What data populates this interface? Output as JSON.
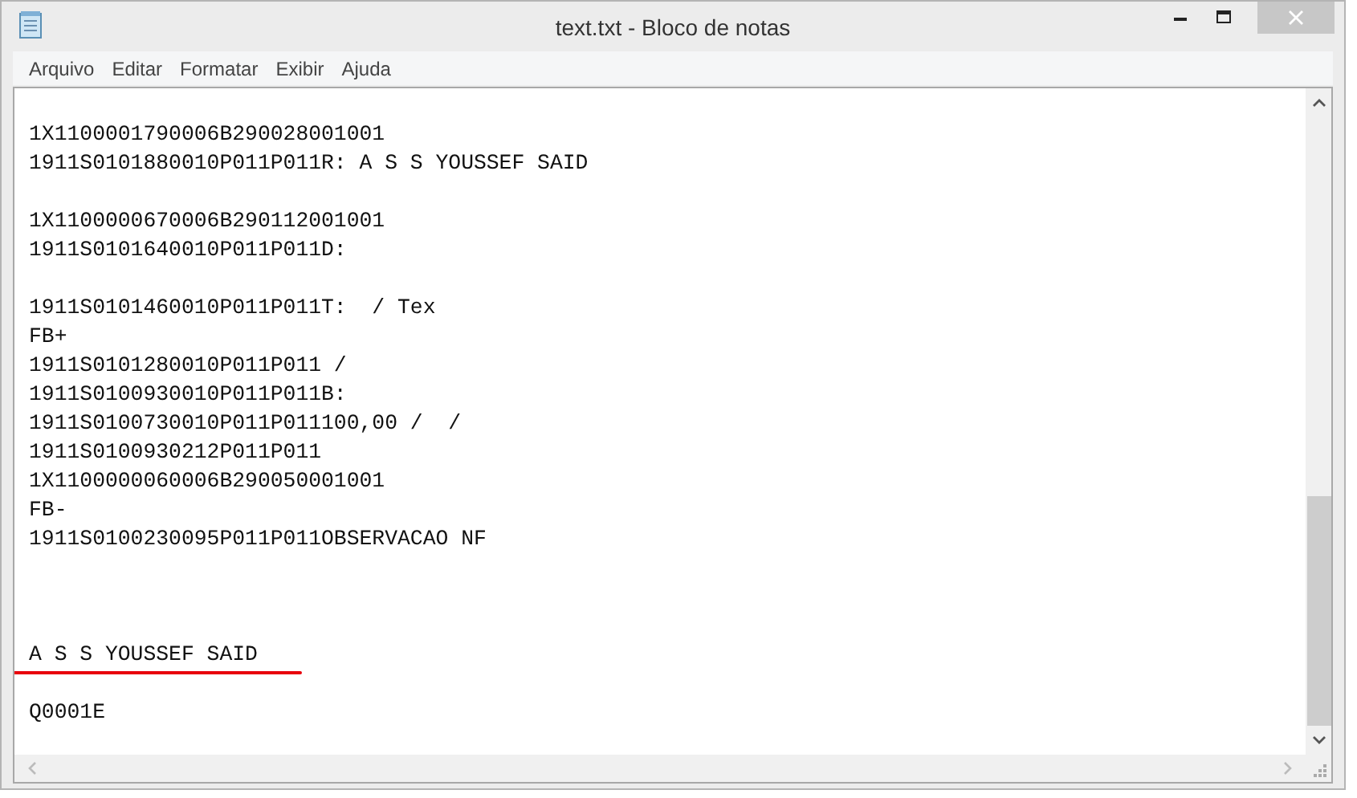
{
  "window": {
    "title": "text.txt - Bloco de notas"
  },
  "menu": [
    "Arquivo",
    "Editar",
    "Formatar",
    "Exibir",
    "Ajuda"
  ],
  "lines": [
    {
      "kind": "text",
      "text": "1X1100001790006B290028001001",
      "marked": false
    },
    {
      "kind": "text",
      "text": "1911S0101880010P011P011R: A S S YOUSSEF SAID",
      "marked": false
    },
    {
      "kind": "blank"
    },
    {
      "kind": "text",
      "text": "1X1100000670006B290112001001",
      "marked": false
    },
    {
      "kind": "text",
      "text": "1911S0101640010P011P011D:",
      "marked": false
    },
    {
      "kind": "blank"
    },
    {
      "kind": "text",
      "text": "1911S0101460010P011P011T:  / Tex",
      "marked": false
    },
    {
      "kind": "text",
      "text": "FB+",
      "marked": false
    },
    {
      "kind": "text",
      "text": "1911S0101280010P011P011 /",
      "marked": false
    },
    {
      "kind": "text",
      "text": "1911S0100930010P011P011B:",
      "marked": false
    },
    {
      "kind": "text",
      "text": "1911S0100730010P011P011100,00 /  /",
      "marked": false
    },
    {
      "kind": "text",
      "text": "1911S0100930212P011P011",
      "marked": false
    },
    {
      "kind": "text",
      "text": "1X1100000060006B290050001001",
      "marked": false
    },
    {
      "kind": "text",
      "text": "FB-",
      "marked": false
    },
    {
      "kind": "text",
      "text": "1911S0100230095P011P011OBSERVACAO NF",
      "marked": false
    },
    {
      "kind": "blank"
    },
    {
      "kind": "blank"
    },
    {
      "kind": "blank"
    },
    {
      "kind": "text",
      "text": "A S S YOUSSEF SAID",
      "marked": true
    },
    {
      "kind": "blank"
    },
    {
      "kind": "text",
      "text": "Q0001E",
      "marked": false
    }
  ]
}
